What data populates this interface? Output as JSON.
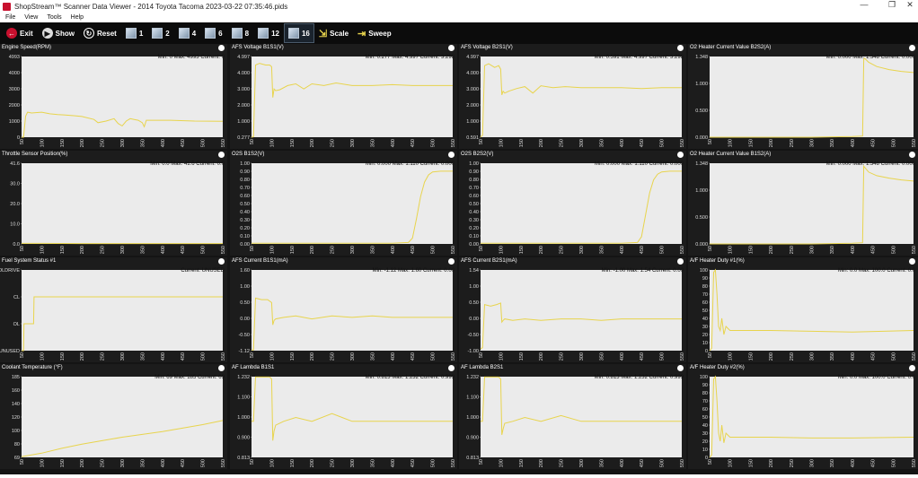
{
  "window": {
    "title": "ShopStream™ Scanner Data Viewer - 2014 Toyota Tacoma 2023-03-22 07:35:46.pids",
    "controls": [
      "—",
      "❐",
      "✕"
    ]
  },
  "menu": [
    "File",
    "View",
    "Tools",
    "Help"
  ],
  "toolbar": {
    "exit": "Exit",
    "show": "Show",
    "reset": "Reset",
    "grid_options": [
      "1",
      "2",
      "4",
      "6",
      "8",
      "12",
      "16"
    ],
    "selected_grid": "16",
    "scale": "Scale",
    "sweep": "Sweep"
  },
  "colors": {
    "trace": "#e8d44d",
    "plot_bg": "#ebebeb",
    "panel_bg": "#1c1c1c",
    "exit_icon": "#c8102e"
  },
  "x_ticks": [
    "50",
    "100",
    "150",
    "200",
    "250",
    "300",
    "350",
    "400",
    "450",
    "500",
    "550"
  ],
  "panels": [
    {
      "title": "Engine Speed(RPM)",
      "stats": "Min: 0     Max: 4993     Current: 0",
      "yticks": [
        "4993",
        "4000",
        "3000",
        "2000",
        "1000",
        "0"
      ],
      "chart_data": {
        "type": "line",
        "ylim": [
          0,
          4993
        ],
        "x": [
          50,
          55,
          60,
          65,
          75,
          85,
          100,
          120,
          140,
          155,
          180,
          200,
          230,
          240,
          260,
          280,
          290,
          300,
          310,
          320,
          330,
          340,
          350,
          355,
          360,
          380,
          420,
          480,
          550
        ],
        "y": [
          0,
          0,
          1300,
          1550,
          1500,
          1520,
          1550,
          1450,
          1400,
          1380,
          1330,
          1280,
          1100,
          900,
          1000,
          1150,
          850,
          700,
          1000,
          1150,
          1100,
          1050,
          900,
          650,
          1050,
          1050,
          1050,
          1000,
          980
        ]
      }
    },
    {
      "title": "AFS Voltage B1S1(V)",
      "stats": "Min: 0.277     Max: 4.997     Current: 3.298",
      "yticks": [
        "4.997",
        "4.000",
        "3.000",
        "2.000",
        "1.000",
        "0.277"
      ],
      "chart_data": {
        "type": "line",
        "ylim": [
          0.277,
          4.997
        ],
        "x": [
          50,
          55,
          60,
          70,
          85,
          95,
          100,
          103,
          106,
          110,
          120,
          140,
          160,
          180,
          200,
          230,
          260,
          300,
          350,
          400,
          450,
          500,
          550
        ],
        "y": [
          0.277,
          0.3,
          4.5,
          4.6,
          4.5,
          4.5,
          4.4,
          2.6,
          3.1,
          3.0,
          3.05,
          3.3,
          3.4,
          3.1,
          3.4,
          3.3,
          3.45,
          3.3,
          3.3,
          3.35,
          3.3,
          3.3,
          3.3
        ]
      }
    },
    {
      "title": "AFS Voltage B2S1(V)",
      "stats": "Min: 0.591     Max: 4.997     Current: 3.298",
      "yticks": [
        "4.997",
        "4.000",
        "3.000",
        "2.000",
        "1.000",
        "0.591"
      ],
      "chart_data": {
        "type": "line",
        "ylim": [
          0.591,
          4.997
        ],
        "x": [
          50,
          55,
          60,
          70,
          85,
          95,
          100,
          103,
          106,
          110,
          120,
          140,
          160,
          180,
          200,
          230,
          260,
          300,
          350,
          400,
          450,
          500,
          550
        ],
        "y": [
          0.6,
          0.7,
          4.5,
          4.6,
          4.4,
          4.5,
          4.3,
          2.9,
          3.1,
          3.0,
          3.1,
          3.25,
          3.35,
          3.0,
          3.4,
          3.3,
          3.35,
          3.3,
          3.3,
          3.3,
          3.25,
          3.3,
          3.3
        ]
      }
    },
    {
      "title": "O2 Heater Current Value B2S2(A)",
      "stats": "Min: 0.000     Max: 1.348     Current: 0.000",
      "yticks": [
        "1.348",
        "1.000",
        "0.500",
        "0.000"
      ],
      "chart_data": {
        "type": "line",
        "ylim": [
          0,
          1.348
        ],
        "x": [
          50,
          100,
          200,
          300,
          400,
          425,
          428,
          430,
          440,
          460,
          490,
          520,
          550
        ],
        "y": [
          0,
          0,
          0,
          0,
          0.01,
          0.02,
          1.3,
          1.32,
          1.25,
          1.18,
          1.13,
          1.1,
          1.08
        ]
      }
    },
    {
      "title": "Throttle Sensor Position(%)",
      "stats": "Min: 0.0     Max: 41.6     Current: 0.0",
      "yticks": [
        "41.6",
        "30.0",
        "20.0",
        "10.0",
        "0.0"
      ],
      "chart_data": {
        "type": "line",
        "ylim": [
          0,
          41.6
        ],
        "x": [
          50,
          100,
          200,
          300,
          400,
          500,
          550
        ],
        "y": [
          0.3,
          0.3,
          0.2,
          0.2,
          0.2,
          0.2,
          0.2
        ]
      }
    },
    {
      "title": "O2S B1S2(V)",
      "stats": "Min: 0.000     Max: 1.110     Current: 0.000",
      "yticks": [
        "1.00",
        "0.90",
        "0.80",
        "0.70",
        "0.60",
        "0.50",
        "0.40",
        "0.30",
        "0.20",
        "0.10",
        "0.00"
      ],
      "chart_data": {
        "type": "line",
        "ylim": [
          0,
          1.11
        ],
        "x": [
          50,
          100,
          200,
          300,
          400,
          440,
          450,
          460,
          470,
          480,
          490,
          500,
          520,
          550
        ],
        "y": [
          0.01,
          0.01,
          0.01,
          0.01,
          0.01,
          0.02,
          0.08,
          0.35,
          0.65,
          0.85,
          0.95,
          0.99,
          1.0,
          1.0
        ]
      }
    },
    {
      "title": "O2S B2S2(V)",
      "stats": "Min: 0.000     Max: 1.110     Current: 0.000",
      "yticks": [
        "1.00",
        "0.90",
        "0.80",
        "0.70",
        "0.60",
        "0.50",
        "0.40",
        "0.30",
        "0.20",
        "0.10",
        "0.00"
      ],
      "chart_data": {
        "type": "line",
        "ylim": [
          0,
          1.11
        ],
        "x": [
          50,
          100,
          200,
          300,
          400,
          440,
          450,
          460,
          470,
          480,
          490,
          500,
          520,
          550
        ],
        "y": [
          0.01,
          0.01,
          0.01,
          0.01,
          0.01,
          0.02,
          0.1,
          0.4,
          0.7,
          0.88,
          0.96,
          0.99,
          1.0,
          1.0
        ]
      }
    },
    {
      "title": "O2 Heater Current Value B1S2(A)",
      "stats": "Min: 0.000     Max: 1.348     Current: 0.000",
      "yticks": [
        "1.348",
        "1.000",
        "0.500",
        "0.000"
      ],
      "chart_data": {
        "type": "line",
        "ylim": [
          0,
          1.348
        ],
        "x": [
          50,
          100,
          200,
          300,
          400,
          425,
          428,
          430,
          440,
          460,
          490,
          520,
          550
        ],
        "y": [
          0,
          0,
          0,
          0,
          0.01,
          0.02,
          1.3,
          1.28,
          1.2,
          1.14,
          1.1,
          1.07,
          1.05
        ]
      }
    },
    {
      "title": "Fuel System Status #1",
      "stats": "Current: UNUSED",
      "yticks": [
        "OLDRIVE",
        "CL",
        "OL",
        "UNUSED"
      ],
      "chart_data": {
        "type": "line",
        "ylim": [
          0,
          3
        ],
        "categories": [
          "UNUSED",
          "OL",
          "CL",
          "OLDRIVE"
        ],
        "x": [
          50,
          55,
          56,
          80,
          81,
          550
        ],
        "y": [
          0,
          0,
          1,
          1,
          2,
          2
        ]
      }
    },
    {
      "title": "AFS Current B1S1(mA)",
      "stats": "Min: -1.12     Max: 1.60     Current: 0.00",
      "yticks": [
        "1.60",
        "1.00",
        "0.50",
        "0.00",
        "-0.50",
        "-1.12"
      ],
      "chart_data": {
        "type": "line",
        "ylim": [
          -1.12,
          1.6
        ],
        "x": [
          50,
          55,
          60,
          75,
          90,
          100,
          103,
          106,
          110,
          130,
          160,
          200,
          250,
          300,
          350,
          400,
          450,
          500,
          550
        ],
        "y": [
          -1.1,
          -1.1,
          0.65,
          0.6,
          0.6,
          0.5,
          -0.25,
          -0.1,
          -0.05,
          0.0,
          0.05,
          -0.05,
          0.05,
          0.0,
          0.05,
          0.0,
          0.0,
          0.0,
          0.0
        ]
      }
    },
    {
      "title": "AFS Current B2S1(mA)",
      "stats": "Min: -1.00     Max: 1.54     Current: 0.00",
      "yticks": [
        "1.54",
        "1.00",
        "0.50",
        "0.00",
        "-0.50",
        "-1.00"
      ],
      "chart_data": {
        "type": "line",
        "ylim": [
          -1.0,
          1.54
        ],
        "x": [
          50,
          55,
          60,
          75,
          90,
          100,
          103,
          106,
          110,
          130,
          160,
          200,
          250,
          300,
          350,
          400,
          450,
          500,
          550
        ],
        "y": [
          -0.95,
          -0.9,
          0.45,
          0.4,
          0.45,
          0.5,
          -0.1,
          -0.05,
          0.0,
          -0.05,
          0.0,
          -0.05,
          0.0,
          0.0,
          -0.05,
          0.0,
          0.0,
          0.0,
          0.0
        ]
      }
    },
    {
      "title": "A/F Heater Duty #1(%)",
      "stats": "Min: 0.0     Max: 100.0     Current: 0.0",
      "yticks": [
        "100",
        "90",
        "80",
        "70",
        "60",
        "50",
        "40",
        "30",
        "20",
        "10",
        "0"
      ],
      "chart_data": {
        "type": "line",
        "ylim": [
          0,
          100
        ],
        "x": [
          50,
          55,
          60,
          64,
          68,
          72,
          76,
          80,
          85,
          90,
          100,
          150,
          200,
          300,
          400,
          550
        ],
        "y": [
          0,
          3,
          97,
          100,
          70,
          30,
          25,
          40,
          20,
          30,
          25,
          25,
          25,
          24,
          23,
          25
        ]
      }
    },
    {
      "title": "Coolant Temperature (°F)",
      "stats": "Min: 69     Max: 185     Current: 69",
      "yticks": [
        "185",
        "160",
        "140",
        "120",
        "100",
        "80",
        "69"
      ],
      "chart_data": {
        "type": "line",
        "ylim": [
          69,
          185
        ],
        "x": [
          50,
          100,
          150,
          200,
          250,
          300,
          350,
          400,
          450,
          500,
          550
        ],
        "y": [
          70,
          75,
          82,
          88,
          93,
          98,
          102,
          106,
          111,
          116,
          122
        ]
      }
    },
    {
      "title": "AF Lambda B1S1",
      "stats": "Min: 0.813     Max: 1.232     Current: 0.999",
      "yticks": [
        "1.232",
        "1.100",
        "1.000",
        "0.900",
        "0.813"
      ],
      "chart_data": {
        "type": "line",
        "ylim": [
          0.813,
          1.232
        ],
        "x": [
          50,
          55,
          60,
          70,
          85,
          95,
          100,
          103,
          106,
          110,
          130,
          160,
          200,
          250,
          300,
          350,
          400,
          450,
          500,
          550
        ],
        "y": [
          1.0,
          1.0,
          1.23,
          1.23,
          1.23,
          1.23,
          1.22,
          0.9,
          0.95,
          0.98,
          1.0,
          1.02,
          1.0,
          1.04,
          1.0,
          1.0,
          1.0,
          1.0,
          1.0,
          1.0
        ]
      }
    },
    {
      "title": "AF Lambda B2S1",
      "stats": "Min: 0.813     Max: 1.232     Current: 0.999",
      "yticks": [
        "1.232",
        "1.100",
        "1.000",
        "0.900",
        "0.813"
      ],
      "chart_data": {
        "type": "line",
        "ylim": [
          0.813,
          1.232
        ],
        "x": [
          50,
          55,
          60,
          70,
          85,
          95,
          100,
          103,
          106,
          110,
          130,
          160,
          200,
          250,
          300,
          350,
          400,
          450,
          500,
          550
        ],
        "y": [
          1.0,
          1.0,
          1.23,
          1.23,
          1.23,
          1.23,
          1.22,
          0.93,
          0.96,
          0.99,
          1.0,
          1.02,
          1.0,
          1.03,
          1.0,
          1.0,
          1.0,
          1.0,
          1.0,
          1.0
        ]
      }
    },
    {
      "title": "A/F Heater Duty #2(%)",
      "stats": "Min: 0.0     Max: 100.0     Current: 0.0",
      "yticks": [
        "100",
        "90",
        "80",
        "70",
        "60",
        "50",
        "40",
        "30",
        "20",
        "10",
        "0"
      ],
      "chart_data": {
        "type": "line",
        "ylim": [
          0,
          100
        ],
        "x": [
          50,
          55,
          60,
          64,
          68,
          72,
          76,
          80,
          85,
          90,
          100,
          150,
          200,
          300,
          400,
          550
        ],
        "y": [
          0,
          3,
          97,
          100,
          70,
          30,
          20,
          40,
          18,
          30,
          25,
          25,
          25,
          24,
          24,
          25
        ]
      }
    }
  ]
}
